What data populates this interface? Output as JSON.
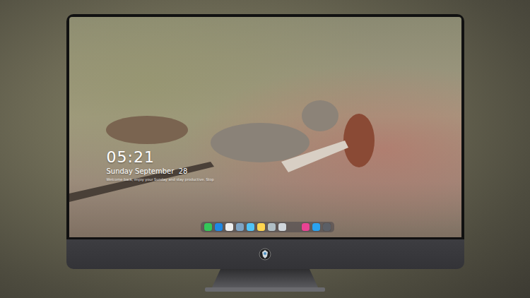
{
  "screen": {
    "time": "05:21",
    "date": "Sunday September  28",
    "note": "Welcome back, enjoy your Sunday and stay productive.   Stop"
  },
  "dock": {
    "apps": [
      {
        "color": "#34c759"
      },
      {
        "color": "#1e88e5"
      },
      {
        "color": "#eeeeee"
      },
      {
        "color": "#7fa4c4"
      },
      {
        "color": "#4fc3f7"
      },
      {
        "color": "#ffd54f"
      },
      {
        "color": "#b0bec5"
      },
      {
        "color": "#d0d6dc"
      }
    ],
    "pinned": [
      {
        "color": "#e84393"
      },
      {
        "color": "#29a3ef"
      },
      {
        "color": "#5b5f66"
      }
    ]
  }
}
